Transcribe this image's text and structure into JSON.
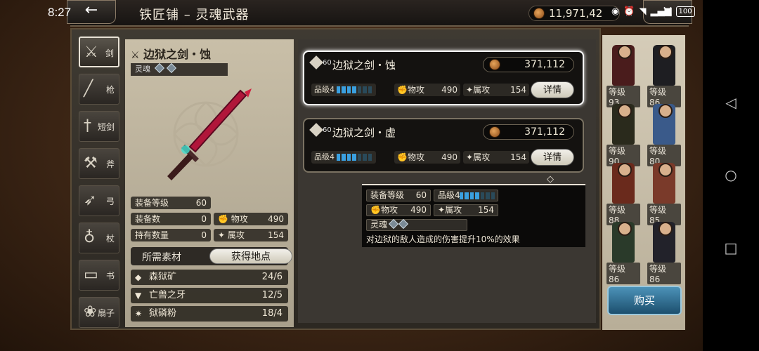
{
  "status": {
    "time": "8:27",
    "battery": "100"
  },
  "header": {
    "title": "铁匠铺 – 灵魂武器",
    "currency": "11,971,42"
  },
  "tabs": [
    {
      "label": "剑",
      "icon": "sword-icon"
    },
    {
      "label": "枪",
      "icon": "spear-icon"
    },
    {
      "label": "短剑",
      "icon": "dagger-icon"
    },
    {
      "label": "斧",
      "icon": "axe-icon"
    },
    {
      "label": "弓",
      "icon": "bow-icon"
    },
    {
      "label": "杖",
      "icon": "staff-icon"
    },
    {
      "label": "书",
      "icon": "book-icon"
    },
    {
      "label": "扇子",
      "icon": "fan-icon"
    }
  ],
  "detail": {
    "name": "边狱之剑・蚀",
    "soul_label": "灵魂",
    "stats": [
      {
        "label": "装备等级",
        "value": "60"
      },
      {
        "label": "装备数",
        "value": "0"
      },
      {
        "label": "物攻",
        "value": "490"
      },
      {
        "label": "持有数量",
        "value": "0"
      },
      {
        "label": "属攻",
        "value": "154"
      }
    ],
    "materials_title": "所需素材",
    "obtain_label": "获得地点",
    "materials": [
      {
        "name": "森狱矿",
        "count": "24/6"
      },
      {
        "name": "亡兽之牙",
        "count": "12/5"
      },
      {
        "name": "狱磷粉",
        "count": "18/4"
      }
    ]
  },
  "weapons": [
    {
      "level": "60",
      "name": "边狱之剑・蚀",
      "price": "371,112",
      "grade": "品级4",
      "grade_value": 4,
      "patk_label": "物攻",
      "patk": "490",
      "eatk_label": "属攻",
      "eatk": "154",
      "detail_label": "详情"
    },
    {
      "level": "60",
      "name": "边狱之剑・虚",
      "price": "371,112",
      "grade": "品级4",
      "grade_value": 4,
      "patk_label": "物攻",
      "patk": "490",
      "eatk_label": "属攻",
      "eatk": "154",
      "detail_label": "详情"
    }
  ],
  "tooltip": {
    "equip_level_label": "装备等级",
    "equip_level": "60",
    "grade": "品级4",
    "patk_label": "物攻",
    "patk": "490",
    "eatk_label": "属攻",
    "eatk": "154",
    "soul_label": "灵魂",
    "description": "对边狱的敌人造成的伤害提升10%的效果"
  },
  "heroes": [
    {
      "level": "等级 93"
    },
    {
      "level": "等级 86"
    },
    {
      "level": "等级 90"
    },
    {
      "level": "等级 80"
    },
    {
      "level": "等级 88"
    },
    {
      "level": "等级 85"
    },
    {
      "level": "等级 86"
    },
    {
      "level": "等级 86"
    }
  ],
  "buy_label": "购买"
}
